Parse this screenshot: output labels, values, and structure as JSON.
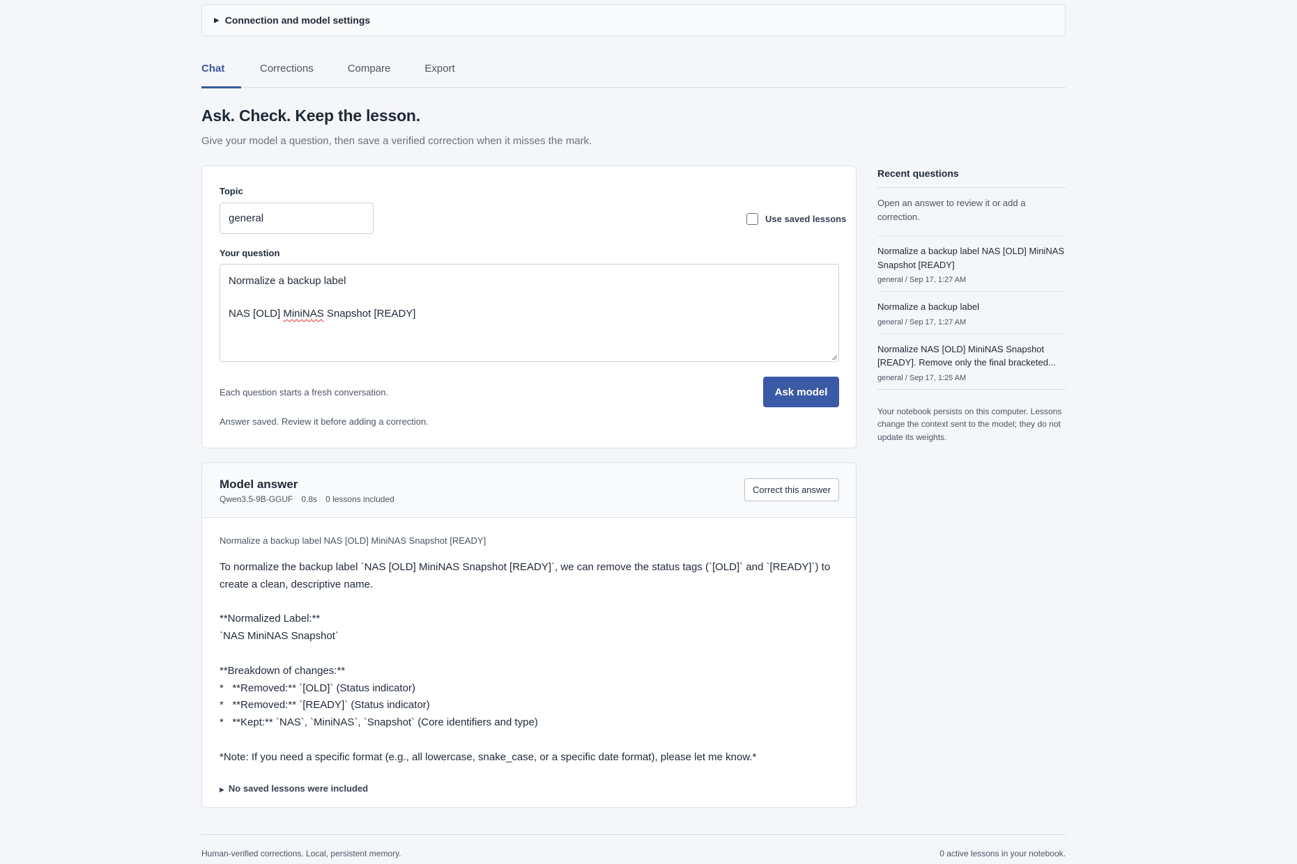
{
  "settings": {
    "label": "Connection and model settings"
  },
  "tabs": [
    {
      "label": "Chat",
      "active": true
    },
    {
      "label": "Corrections"
    },
    {
      "label": "Compare"
    },
    {
      "label": "Export"
    }
  ],
  "page": {
    "title": "Ask. Check. Keep the lesson.",
    "subtitle": "Give your model a question, then save a verified correction when it misses the mark."
  },
  "ask": {
    "topic_label": "Topic",
    "topic_value": "general",
    "use_saved_label": "Use saved lessons",
    "question_label": "Your question",
    "question_line1": "Normalize a backup label",
    "question_line2_pre": "NAS [OLD] ",
    "question_line2_word": "MiniNAS",
    "question_line2_post": " Snapshot [READY]",
    "hint": "Each question starts a fresh conversation.",
    "button": "Ask model",
    "status": "Answer saved. Review it before adding a correction."
  },
  "answer": {
    "title": "Model answer",
    "model": "Qwen3.5-9B-GGUF",
    "time": "0.8s",
    "lessons": "0 lessons included",
    "correct_button": "Correct this answer",
    "echo": "Normalize a backup label NAS [OLD] MiniNAS Snapshot [READY]",
    "body": "To normalize the backup label `NAS [OLD] MiniNAS Snapshot [READY]`, we can remove the status tags (`[OLD]` and `[READY]`) to\ncreate a clean, descriptive name.\n\n**Normalized Label:**\n`NAS MiniNAS Snapshot`\n\n**Breakdown of changes:**\n*   **Removed:** `[OLD]` (Status indicator)\n*   **Removed:** `[READY]` (Status indicator)\n*   **Kept:** `NAS`, `MiniNAS`, `Snapshot` (Core identifiers and type)\n\n*Note: If you need a specific format (e.g., all lowercase, snake_case, or a specific date format), please let me know.*",
    "lessons_toggle": "No saved lessons were included"
  },
  "sidebar": {
    "title": "Recent questions",
    "desc": "Open an answer to review it or add a correction.",
    "items": [
      {
        "q": "Normalize a backup label NAS [OLD] MiniNAS Snapshot [READY]",
        "meta": "general / Sep 17, 1:27 AM"
      },
      {
        "q": "Normalize a backup label",
        "meta": "general / Sep 17, 1:27 AM"
      },
      {
        "q": "Normalize NAS [OLD] MiniNAS Snapshot [READY]. Remove only the final bracketed...",
        "meta": "general / Sep 17, 1:25 AM"
      }
    ],
    "note": "Your notebook persists on this computer. Lessons change the context sent to the model; they do not update its weights."
  },
  "footer": {
    "left": "Human-verified corrections. Local, persistent memory.",
    "right": "0 active lessons in your notebook."
  },
  "colors": {
    "accent": "#3b5aa5",
    "background": "#f4f6f9"
  }
}
